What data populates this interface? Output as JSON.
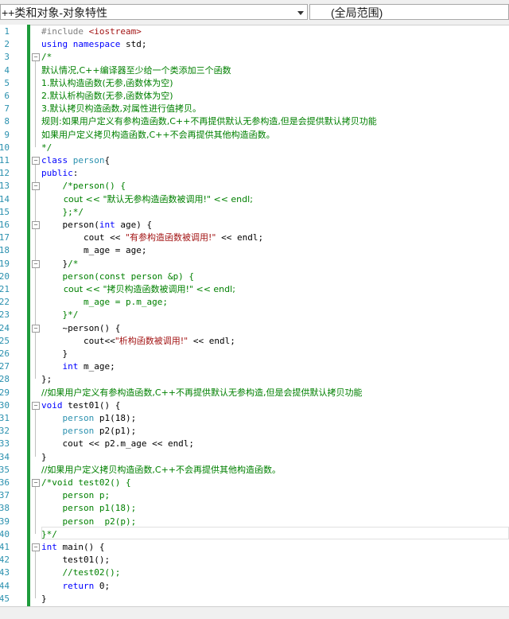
{
  "navbar": {
    "scope_dropdown": "++类和对象-对象特性",
    "member_dropdown": "(全局范围)"
  },
  "colors": {
    "keyword": "#0000ff",
    "comment": "#008000",
    "string": "#a31515",
    "preprocessor": "#808080",
    "type": "#2b91af",
    "line_number": "#2b91af",
    "change_bar": "#1f9c3c"
  },
  "editor": {
    "line_numbers": [
      "1",
      "2",
      "3",
      "4",
      "5",
      "6",
      "7",
      "8",
      "9",
      "10",
      "11",
      "12",
      "13",
      "14",
      "15",
      "16",
      "17",
      "18",
      "19",
      "20",
      "21",
      "22",
      "23",
      "24",
      "25",
      "26",
      "27",
      "28",
      "29",
      "30",
      "31",
      "32",
      "33",
      "34",
      "35",
      "36",
      "37",
      "38",
      "39",
      "40",
      "41",
      "42",
      "43",
      "44",
      "45"
    ],
    "lines": [
      [
        {
          "t": "#include ",
          "c": "pp"
        },
        {
          "t": "<iostream>",
          "c": "st"
        }
      ],
      [
        {
          "t": "using",
          "c": "kw"
        },
        {
          "t": " "
        },
        {
          "t": "namespace",
          "c": "kw"
        },
        {
          "t": " std;"
        }
      ],
      [
        {
          "t": "/*",
          "c": "cm"
        }
      ],
      [
        {
          "t": "默认情况,C++编译器至少给一个类添加三个函数",
          "c": "cm"
        }
      ],
      [
        {
          "t": "1.默认构造函数(无参,函数体为空)",
          "c": "cm"
        }
      ],
      [
        {
          "t": "2.默认析构函数(无参,函数体为空)",
          "c": "cm"
        }
      ],
      [
        {
          "t": "3.默认拷贝构造函数,对属性进行值拷贝。",
          "c": "cm"
        }
      ],
      [
        {
          "t": "规则:如果用户定义有参构造函数,C++不再提供默认无参构造,但是会提供默认拷贝功能",
          "c": "cm"
        }
      ],
      [
        {
          "t": "如果用户定义拷贝构造函数,C++不会再提供其他构造函数。",
          "c": "cm"
        }
      ],
      [
        {
          "t": "*/",
          "c": "cm"
        }
      ],
      [
        {
          "t": "class",
          "c": "kw"
        },
        {
          "t": " "
        },
        {
          "t": "person",
          "c": "ty"
        },
        {
          "t": "{"
        }
      ],
      [
        {
          "t": "public",
          "c": "kw"
        },
        {
          "t": ":"
        }
      ],
      [
        {
          "t": "    "
        },
        {
          "t": "/*person() {",
          "c": "cm"
        }
      ],
      [
        {
          "t": "        cout << \"默认无参构造函数被调用!\" << endl;",
          "c": "cm"
        }
      ],
      [
        {
          "t": "    };*/",
          "c": "cm"
        }
      ],
      [
        {
          "t": "    person("
        },
        {
          "t": "int",
          "c": "kw"
        },
        {
          "t": " age) {"
        }
      ],
      [
        {
          "t": "        cout << "
        },
        {
          "t": "\"有参构造函数被调用!\"",
          "c": "st"
        },
        {
          "t": " << endl;"
        }
      ],
      [
        {
          "t": "        m_age = age;"
        }
      ],
      [
        {
          "t": "    }"
        },
        {
          "t": "/*",
          "c": "cm"
        }
      ],
      [
        {
          "t": "    person(const person &p) {",
          "c": "cm"
        }
      ],
      [
        {
          "t": "        cout << \"拷贝构造函数被调用!\" << endl;",
          "c": "cm"
        }
      ],
      [
        {
          "t": "        m_age = p.m_age;",
          "c": "cm"
        }
      ],
      [
        {
          "t": "    }*/",
          "c": "cm"
        }
      ],
      [
        {
          "t": "    ~person() {"
        }
      ],
      [
        {
          "t": "        cout<<"
        },
        {
          "t": "\"析构函数被调用!\"",
          "c": "st"
        },
        {
          "t": " << endl;"
        }
      ],
      [
        {
          "t": "    }"
        }
      ],
      [
        {
          "t": "    "
        },
        {
          "t": "int",
          "c": "kw"
        },
        {
          "t": " m_age;"
        }
      ],
      [
        {
          "t": "};"
        }
      ],
      [
        {
          "t": "//如果用户定义有参构造函数,C++不再提供默认无参构造,但是会提供默认拷贝功能",
          "c": "cm"
        }
      ],
      [
        {
          "t": "void",
          "c": "kw"
        },
        {
          "t": " test01() {"
        }
      ],
      [
        {
          "t": "    "
        },
        {
          "t": "person",
          "c": "ty"
        },
        {
          "t": " p1(18);"
        }
      ],
      [
        {
          "t": "    "
        },
        {
          "t": "person",
          "c": "ty"
        },
        {
          "t": " p2(p1);"
        }
      ],
      [
        {
          "t": "    cout << p2.m_age << endl;"
        }
      ],
      [
        {
          "t": "}"
        }
      ],
      [
        {
          "t": "//如果用户定义拷贝构造函数,C++不会再提供其他构造函数。",
          "c": "cm"
        }
      ],
      [
        {
          "t": "/*void test02() {",
          "c": "cm"
        }
      ],
      [
        {
          "t": "    person p;",
          "c": "cm"
        }
      ],
      [
        {
          "t": "    person p1(18);",
          "c": "cm"
        }
      ],
      [
        {
          "t": "    person  p2(p);",
          "c": "cm"
        }
      ],
      [
        {
          "t": "}*/",
          "c": "cm"
        }
      ],
      [
        {
          "t": "int",
          "c": "kw"
        },
        {
          "t": " main() {"
        }
      ],
      [
        {
          "t": "    test01();"
        }
      ],
      [
        {
          "t": "    "
        },
        {
          "t": "//test02();",
          "c": "cm"
        }
      ],
      [
        {
          "t": "    "
        },
        {
          "t": "return",
          "c": "kw"
        },
        {
          "t": " 0;"
        }
      ],
      [
        {
          "t": "}"
        }
      ]
    ]
  }
}
